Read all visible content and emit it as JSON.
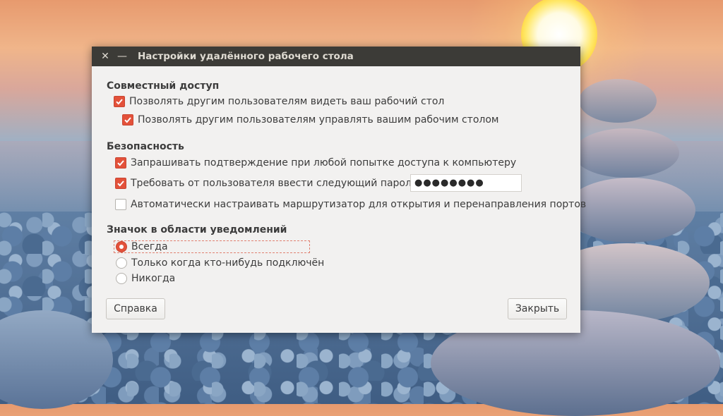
{
  "window": {
    "title": "Настройки удалённого рабочего стола",
    "close_glyph": "✕",
    "minimize_glyph": "—"
  },
  "sharing": {
    "heading": "Совместный доступ",
    "allow_view": {
      "label": "Позволять другим пользователям видеть ваш рабочий стол",
      "checked": true
    },
    "allow_control": {
      "label": "Позволять другим пользователям управлять вашим рабочим столом",
      "checked": true
    }
  },
  "security": {
    "heading": "Безопасность",
    "confirm_access": {
      "label": "Запрашивать подтверждение при любой попытке доступа к компьютеру",
      "checked": true
    },
    "require_password": {
      "label": "Требовать от пользователя ввести следующий пароль:",
      "checked": true
    },
    "password_value": "●●●●●●●●",
    "auto_router": {
      "label": "Автоматически настраивать маршрутизатор для открытия и перенаправления портов",
      "checked": false
    }
  },
  "notification": {
    "heading": "Значок в области уведомлений",
    "options": [
      {
        "label": "Всегда",
        "selected": true
      },
      {
        "label": "Только когда кто-нибудь подключён",
        "selected": false
      },
      {
        "label": "Никогда",
        "selected": false
      }
    ]
  },
  "buttons": {
    "help": "Справка",
    "close": "Закрыть"
  },
  "colors": {
    "accent": "#e3513a",
    "titlebar": "#3c3b37",
    "dialog_bg": "#f2f1f0"
  }
}
